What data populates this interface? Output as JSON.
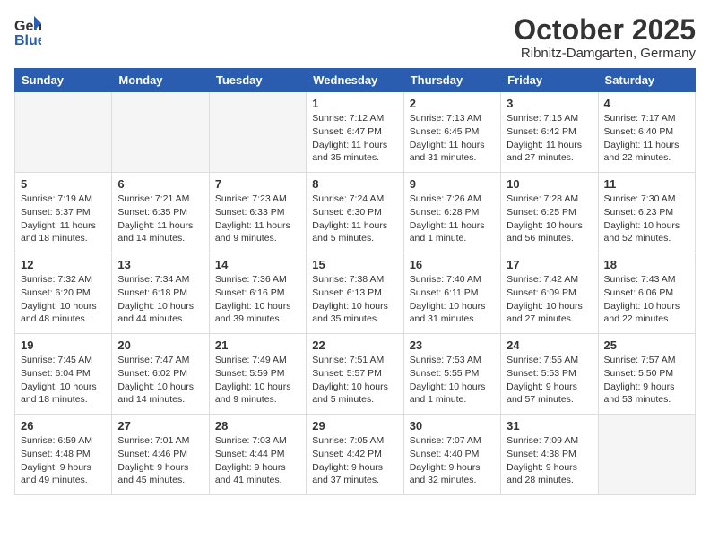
{
  "logo": {
    "general": "General",
    "blue": "Blue"
  },
  "title": "October 2025",
  "subtitle": "Ribnitz-Damgarten, Germany",
  "weekdays": [
    "Sunday",
    "Monday",
    "Tuesday",
    "Wednesday",
    "Thursday",
    "Friday",
    "Saturday"
  ],
  "weeks": [
    [
      {
        "day": "",
        "info": ""
      },
      {
        "day": "",
        "info": ""
      },
      {
        "day": "",
        "info": ""
      },
      {
        "day": "1",
        "info": "Sunrise: 7:12 AM\nSunset: 6:47 PM\nDaylight: 11 hours\nand 35 minutes."
      },
      {
        "day": "2",
        "info": "Sunrise: 7:13 AM\nSunset: 6:45 PM\nDaylight: 11 hours\nand 31 minutes."
      },
      {
        "day": "3",
        "info": "Sunrise: 7:15 AM\nSunset: 6:42 PM\nDaylight: 11 hours\nand 27 minutes."
      },
      {
        "day": "4",
        "info": "Sunrise: 7:17 AM\nSunset: 6:40 PM\nDaylight: 11 hours\nand 22 minutes."
      }
    ],
    [
      {
        "day": "5",
        "info": "Sunrise: 7:19 AM\nSunset: 6:37 PM\nDaylight: 11 hours\nand 18 minutes."
      },
      {
        "day": "6",
        "info": "Sunrise: 7:21 AM\nSunset: 6:35 PM\nDaylight: 11 hours\nand 14 minutes."
      },
      {
        "day": "7",
        "info": "Sunrise: 7:23 AM\nSunset: 6:33 PM\nDaylight: 11 hours\nand 9 minutes."
      },
      {
        "day": "8",
        "info": "Sunrise: 7:24 AM\nSunset: 6:30 PM\nDaylight: 11 hours\nand 5 minutes."
      },
      {
        "day": "9",
        "info": "Sunrise: 7:26 AM\nSunset: 6:28 PM\nDaylight: 11 hours\nand 1 minute."
      },
      {
        "day": "10",
        "info": "Sunrise: 7:28 AM\nSunset: 6:25 PM\nDaylight: 10 hours\nand 56 minutes."
      },
      {
        "day": "11",
        "info": "Sunrise: 7:30 AM\nSunset: 6:23 PM\nDaylight: 10 hours\nand 52 minutes."
      }
    ],
    [
      {
        "day": "12",
        "info": "Sunrise: 7:32 AM\nSunset: 6:20 PM\nDaylight: 10 hours\nand 48 minutes."
      },
      {
        "day": "13",
        "info": "Sunrise: 7:34 AM\nSunset: 6:18 PM\nDaylight: 10 hours\nand 44 minutes."
      },
      {
        "day": "14",
        "info": "Sunrise: 7:36 AM\nSunset: 6:16 PM\nDaylight: 10 hours\nand 39 minutes."
      },
      {
        "day": "15",
        "info": "Sunrise: 7:38 AM\nSunset: 6:13 PM\nDaylight: 10 hours\nand 35 minutes."
      },
      {
        "day": "16",
        "info": "Sunrise: 7:40 AM\nSunset: 6:11 PM\nDaylight: 10 hours\nand 31 minutes."
      },
      {
        "day": "17",
        "info": "Sunrise: 7:42 AM\nSunset: 6:09 PM\nDaylight: 10 hours\nand 27 minutes."
      },
      {
        "day": "18",
        "info": "Sunrise: 7:43 AM\nSunset: 6:06 PM\nDaylight: 10 hours\nand 22 minutes."
      }
    ],
    [
      {
        "day": "19",
        "info": "Sunrise: 7:45 AM\nSunset: 6:04 PM\nDaylight: 10 hours\nand 18 minutes."
      },
      {
        "day": "20",
        "info": "Sunrise: 7:47 AM\nSunset: 6:02 PM\nDaylight: 10 hours\nand 14 minutes."
      },
      {
        "day": "21",
        "info": "Sunrise: 7:49 AM\nSunset: 5:59 PM\nDaylight: 10 hours\nand 9 minutes."
      },
      {
        "day": "22",
        "info": "Sunrise: 7:51 AM\nSunset: 5:57 PM\nDaylight: 10 hours\nand 5 minutes."
      },
      {
        "day": "23",
        "info": "Sunrise: 7:53 AM\nSunset: 5:55 PM\nDaylight: 10 hours\nand 1 minute."
      },
      {
        "day": "24",
        "info": "Sunrise: 7:55 AM\nSunset: 5:53 PM\nDaylight: 9 hours\nand 57 minutes."
      },
      {
        "day": "25",
        "info": "Sunrise: 7:57 AM\nSunset: 5:50 PM\nDaylight: 9 hours\nand 53 minutes."
      }
    ],
    [
      {
        "day": "26",
        "info": "Sunrise: 6:59 AM\nSunset: 4:48 PM\nDaylight: 9 hours\nand 49 minutes."
      },
      {
        "day": "27",
        "info": "Sunrise: 7:01 AM\nSunset: 4:46 PM\nDaylight: 9 hours\nand 45 minutes."
      },
      {
        "day": "28",
        "info": "Sunrise: 7:03 AM\nSunset: 4:44 PM\nDaylight: 9 hours\nand 41 minutes."
      },
      {
        "day": "29",
        "info": "Sunrise: 7:05 AM\nSunset: 4:42 PM\nDaylight: 9 hours\nand 37 minutes."
      },
      {
        "day": "30",
        "info": "Sunrise: 7:07 AM\nSunset: 4:40 PM\nDaylight: 9 hours\nand 32 minutes."
      },
      {
        "day": "31",
        "info": "Sunrise: 7:09 AM\nSunset: 4:38 PM\nDaylight: 9 hours\nand 28 minutes."
      },
      {
        "day": "",
        "info": ""
      }
    ]
  ]
}
